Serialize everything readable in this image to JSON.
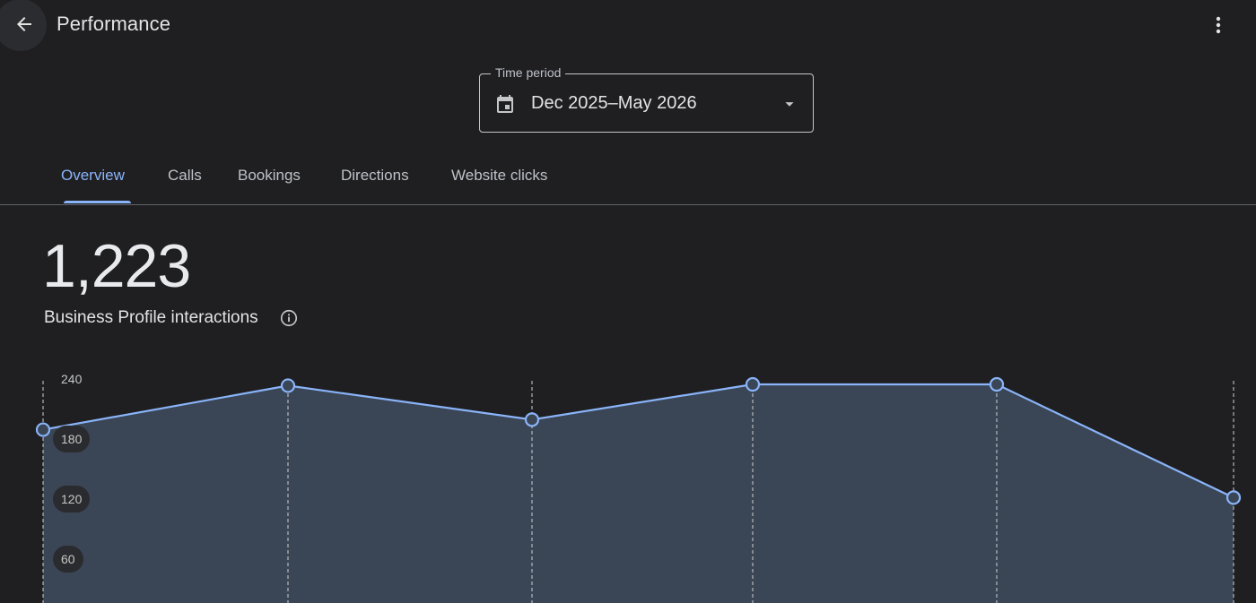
{
  "header": {
    "title": "Performance",
    "back_icon": "arrow-back-icon",
    "menu_icon": "more-vert-icon"
  },
  "time_period": {
    "label": "Time period",
    "value": "Dec 2025–May 2026",
    "icon": "calendar-icon",
    "dropdown_icon": "arrow-drop-down-icon"
  },
  "tabs": [
    {
      "label": "Overview",
      "active": true
    },
    {
      "label": "Calls",
      "active": false
    },
    {
      "label": "Bookings",
      "active": false
    },
    {
      "label": "Directions",
      "active": false
    },
    {
      "label": "Website clicks",
      "active": false
    }
  ],
  "metric": {
    "value": "1,223",
    "label": "Business Profile interactions",
    "info_icon": "info-icon"
  },
  "colors": {
    "background": "#1f1f22",
    "accent": "#8ab4f8",
    "area_fill": "#3a4556"
  },
  "chart_data": {
    "type": "area",
    "x": [
      0,
      1,
      2,
      3,
      4,
      5
    ],
    "values": [
      199,
      234,
      207,
      235,
      235,
      145
    ],
    "ylim": [
      0,
      240
    ],
    "ytick_labels": [
      "240",
      "180",
      "120",
      "60"
    ],
    "grid": "vertical-dashed"
  }
}
